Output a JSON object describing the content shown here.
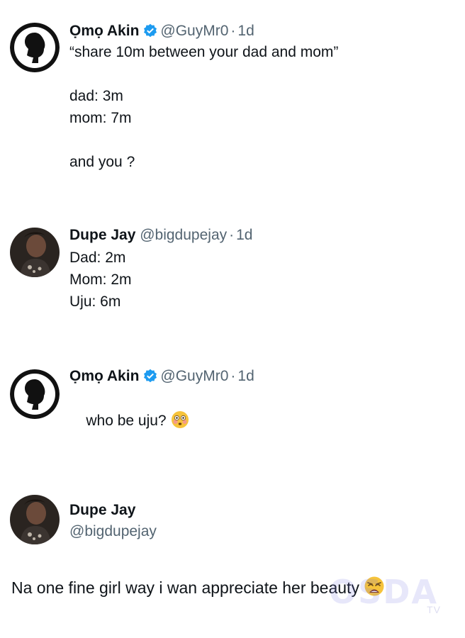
{
  "tweets": [
    {
      "name": "Ọmọ Akin",
      "verified": true,
      "handle": "@GuyMr0",
      "separator": "·",
      "time": "1d",
      "text": "“share 10m between your dad and mom”\n\ndad: 3m\nmom: 7m\n\nand you ?"
    },
    {
      "name": "Dupe Jay",
      "verified": false,
      "handle": "@bigdupejay",
      "separator": "·",
      "time": "1d",
      "text": "Dad: 2m\nMom: 2m\nUju: 6m"
    },
    {
      "name": "Ọmọ Akin",
      "verified": true,
      "handle": "@GuyMr0",
      "separator": "·",
      "time": "1d",
      "text": "who be uju?",
      "emoji": "flushed-face"
    },
    {
      "name": "Dupe Jay",
      "handle": "@bigdupejay",
      "text": "Na one fine girl way i wan appreciate her beauty",
      "emoji": "weary-face"
    }
  ],
  "colors": {
    "text": "#0f1419",
    "secondary": "#536471",
    "verified": "#1d9bf0"
  }
}
